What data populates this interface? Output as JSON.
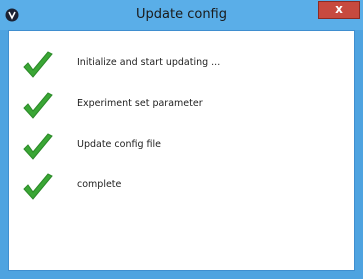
{
  "window": {
    "title": "Update config",
    "close_label": "x"
  },
  "icons": {
    "app": "app-logo-icon",
    "step_status": "checkmark-icon"
  },
  "colors": {
    "titlebar": "#5aaee8",
    "frame": "#4ea3e0",
    "close_button": "#c74a3f",
    "check_green": "#3aa635"
  },
  "steps": [
    {
      "label": "Initialize and start updating ..."
    },
    {
      "label": "Experiment set parameter"
    },
    {
      "label": "Update config file"
    },
    {
      "label": "complete"
    }
  ]
}
